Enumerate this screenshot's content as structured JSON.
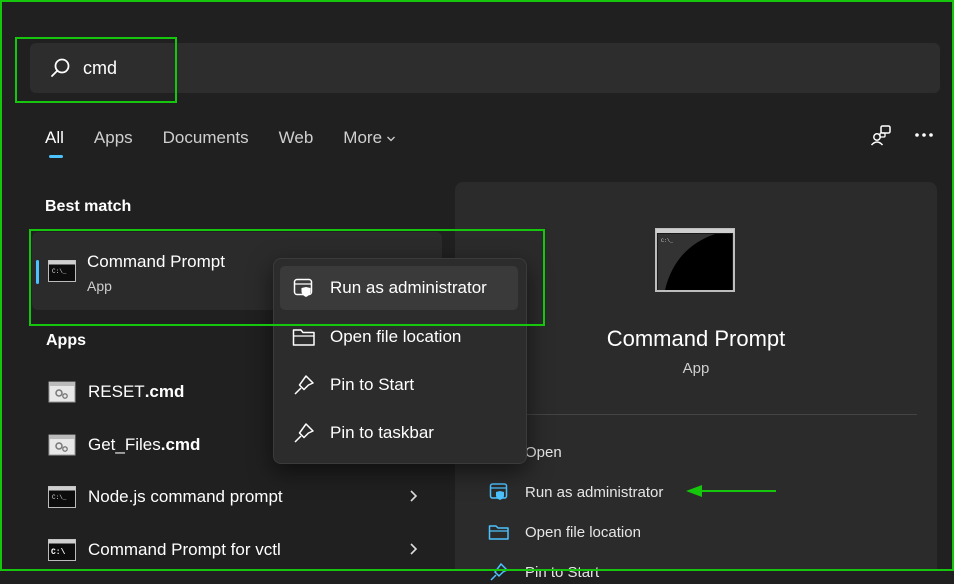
{
  "search": {
    "query": "cmd",
    "icon": "search-icon"
  },
  "tabs": [
    {
      "label": "All",
      "active": true
    },
    {
      "label": "Apps"
    },
    {
      "label": "Documents"
    },
    {
      "label": "Web"
    },
    {
      "label": "More"
    }
  ],
  "best_match": {
    "section_title": "Best match",
    "name": "Command Prompt",
    "type": "App"
  },
  "apps": {
    "section_title": "Apps",
    "items": [
      {
        "name_prefix": "RESET",
        "name_bold": ".cmd"
      },
      {
        "name_prefix": "Get_Files",
        "name_bold": ".cmd"
      },
      {
        "name_prefix": "Node.js command prompt",
        "name_bold": ""
      },
      {
        "name_prefix": "Command Prompt for vctl",
        "name_bold": ""
      }
    ]
  },
  "context_menu": {
    "items": [
      {
        "label": "Run as administrator",
        "icon": "shield-window-icon",
        "highlighted": true
      },
      {
        "label": "Open file location",
        "icon": "folder-icon"
      },
      {
        "label": "Pin to Start",
        "icon": "pin-icon"
      },
      {
        "label": "Pin to taskbar",
        "icon": "pin-icon"
      }
    ]
  },
  "details": {
    "title": "Command Prompt",
    "subtitle": "App",
    "actions": [
      {
        "label": "Open",
        "icon": "open-icon"
      },
      {
        "label": "Run as administrator",
        "icon": "shield-window-icon"
      },
      {
        "label": "Open file location",
        "icon": "folder-icon"
      },
      {
        "label": "Pin to Start",
        "icon": "pin-icon"
      }
    ]
  },
  "colors": {
    "accent": "#4cc2ff",
    "annotation": "#16c60c",
    "background": "#202020"
  }
}
